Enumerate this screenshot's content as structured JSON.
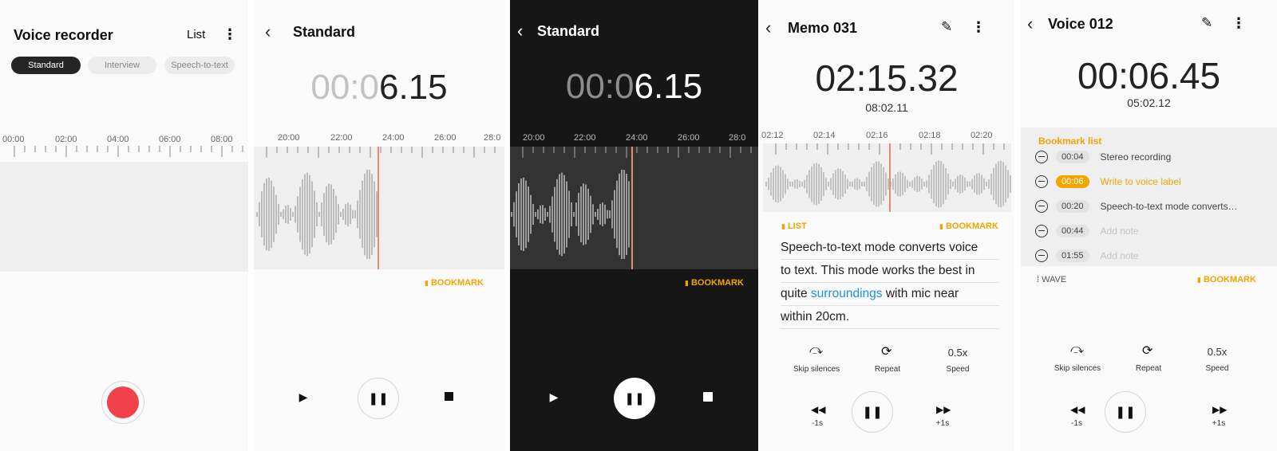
{
  "panel1": {
    "title": "Voice recorder",
    "list_label": "List",
    "more_icon": "⋮",
    "modes": [
      "Standard",
      "Interview",
      "Speech-to-text"
    ],
    "ruler_labels": [
      "00:00",
      "02:00",
      "04:00",
      "06:00",
      "08:00"
    ]
  },
  "panel2": {
    "title": "Standard",
    "timer_dim": "00:0",
    "timer_bright": "6.15",
    "ruler_labels": [
      "20:00",
      "22:00",
      "24:00",
      "26:00",
      "28:0"
    ],
    "bookmark_label": "BOOKMARK"
  },
  "panel3": {
    "title": "Standard",
    "timer_dim": "00:0",
    "timer_bright": "6.15",
    "ruler_labels": [
      "20:00",
      "22:00",
      "24:00",
      "26:00",
      "28:0"
    ],
    "bookmark_label": "BOOKMARK"
  },
  "panel4": {
    "title": "Memo 031",
    "timer": "02:15.32",
    "total": "08:02.11",
    "ruler_labels": [
      "02:12",
      "02:14",
      "02:16",
      "02:18",
      "02:20"
    ],
    "list_label": "LIST",
    "bookmark_label": "BOOKMARK",
    "text_lines": [
      "Speech-to-text mode converts voice",
      "to text. This mode works the best in",
      "quite ",
      "surroundings",
      " with mic near",
      "within 20cm."
    ],
    "controls": {
      "skip": "Skip silences",
      "repeat": "Repeat",
      "speed_value": "0.5x",
      "speed": "Speed",
      "rewind": "-1s",
      "forward": "+1s"
    }
  },
  "panel5": {
    "title": "Voice 012",
    "timer": "00:06.45",
    "total": "05:02.12",
    "bookmark_list_title": "Bookmark list",
    "bookmarks": [
      {
        "time": "00:04",
        "note": "Stereo recording",
        "active": false,
        "placeholder": false
      },
      {
        "time": "00:06",
        "note": "Write to voice label",
        "active": true,
        "placeholder": false
      },
      {
        "time": "00:20",
        "note": "Speech-to-text mode converts…",
        "active": false,
        "placeholder": false
      },
      {
        "time": "00:44",
        "note": "Add note",
        "active": false,
        "placeholder": true
      },
      {
        "time": "01:55",
        "note": "Add note",
        "active": false,
        "placeholder": true
      }
    ],
    "wave_label": "WAVE",
    "bookmark_label": "BOOKMARK",
    "controls": {
      "skip": "Skip silences",
      "repeat": "Repeat",
      "speed_value": "0.5x",
      "speed": "Speed",
      "rewind": "-1s",
      "forward": "+1s"
    }
  },
  "colors": {
    "accent": "#f0a500",
    "record": "#f1414b",
    "playhead": "#e8897f",
    "link": "#1a8fe6"
  }
}
